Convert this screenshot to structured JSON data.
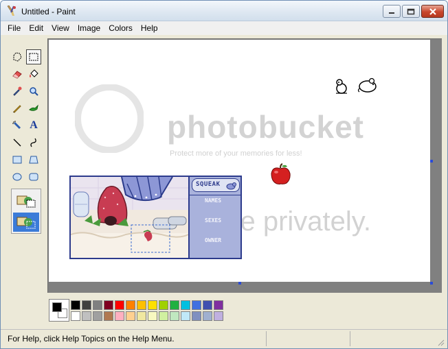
{
  "window": {
    "title": "Untitled - Paint"
  },
  "menu": [
    {
      "label": "File"
    },
    {
      "label": "Edit"
    },
    {
      "label": "View"
    },
    {
      "label": "Image"
    },
    {
      "label": "Colors"
    },
    {
      "label": "Help"
    }
  ],
  "tools": [
    {
      "name": "free-form-select-icon"
    },
    {
      "name": "select-icon",
      "selected": true
    },
    {
      "name": "eraser-icon"
    },
    {
      "name": "fill-with-color-icon"
    },
    {
      "name": "pick-color-icon"
    },
    {
      "name": "magnifier-icon"
    },
    {
      "name": "pencil-icon"
    },
    {
      "name": "brush-icon"
    },
    {
      "name": "airbrush-icon"
    },
    {
      "name": "text-icon"
    },
    {
      "name": "line-icon"
    },
    {
      "name": "curve-icon"
    },
    {
      "name": "rectangle-icon"
    },
    {
      "name": "polygon-icon"
    },
    {
      "name": "ellipse-icon"
    },
    {
      "name": "rounded-rectangle-icon"
    }
  ],
  "tool_text_glyph": "A",
  "canvas": {
    "layout_panel": {
      "header": "SQUEAK",
      "rows": [
        "NAMES",
        "SEXES",
        "OWNER"
      ]
    }
  },
  "watermark": {
    "line1": "photobucket",
    "line2": "Protect more of your memories for less!",
    "line3": "Share privately."
  },
  "palette": {
    "foreground": "#000000",
    "background": "#ffffff",
    "row1": [
      "#000000",
      "#404040",
      "#808080",
      "#800020",
      "#ff0000",
      "#ff8000",
      "#ffc000",
      "#ffe000",
      "#a0d000",
      "#20b040",
      "#00c0e0",
      "#4070e0",
      "#4050b0",
      "#8030a0"
    ],
    "row2": [
      "#ffffff",
      "#c0c0c0",
      "#a0a0a0",
      "#b07850",
      "#ffb0c0",
      "#ffd090",
      "#f0e8a0",
      "#f8f8c0",
      "#d0f0a0",
      "#c0e8c0",
      "#c0e8f8",
      "#8090c0",
      "#a0b0d0",
      "#c0b0e0"
    ]
  },
  "status": {
    "text": "For Help, click Help Topics on the Help Menu."
  }
}
